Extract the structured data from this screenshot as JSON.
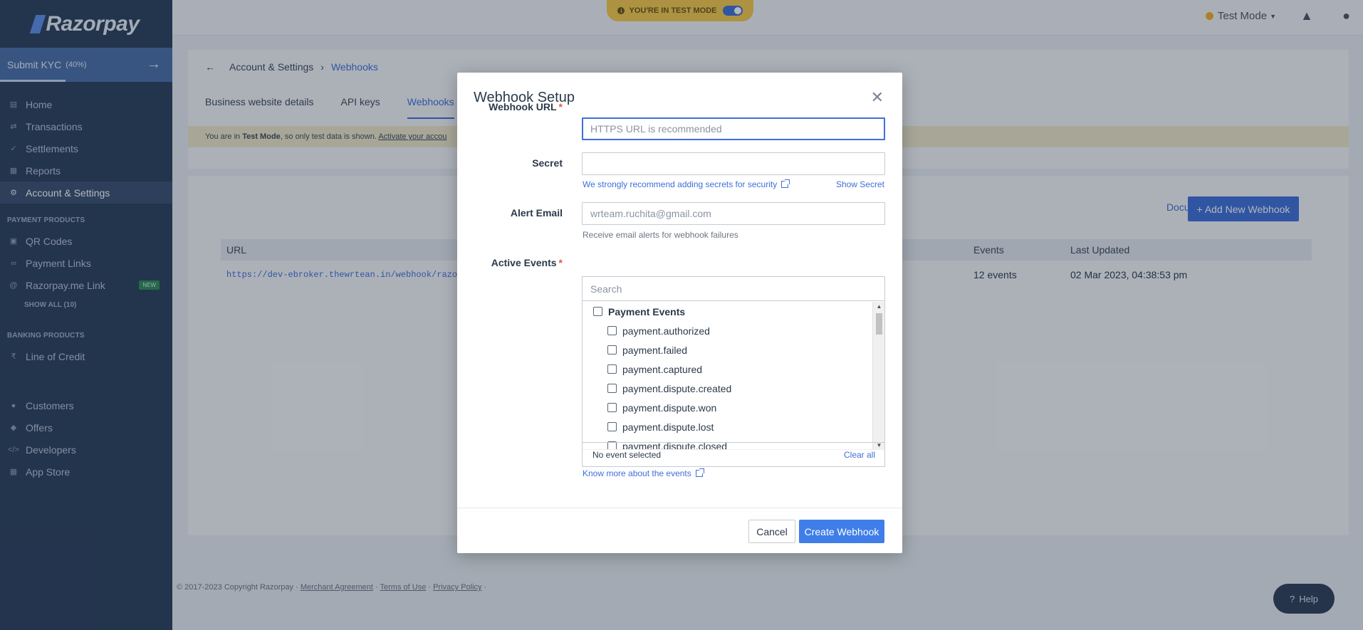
{
  "sidebar": {
    "logo": "Razorpay",
    "kyc": {
      "label": "Submit KYC",
      "percent": "(40%)",
      "progress": 0.4
    },
    "nav": [
      {
        "label": "Home",
        "icon": "home-icon"
      },
      {
        "label": "Transactions",
        "icon": "transactions-icon"
      },
      {
        "label": "Settlements",
        "icon": "settlements-icon"
      },
      {
        "label": "Reports",
        "icon": "reports-icon"
      },
      {
        "label": "Account & Settings",
        "icon": "gear-icon",
        "active": true
      }
    ],
    "payment_products_heading": "PAYMENT PRODUCTS",
    "payment_products": [
      {
        "label": "QR Codes",
        "icon": "qr-code-icon"
      },
      {
        "label": "Payment Links",
        "icon": "link-icon"
      },
      {
        "label": "Razorpay.me Link",
        "icon": "at-icon",
        "badge": "NEW"
      }
    ],
    "show_all": "SHOW ALL (10)",
    "banking_products_heading": "BANKING PRODUCTS",
    "banking_products": [
      {
        "label": "Line of Credit",
        "icon": "rupee-icon"
      }
    ],
    "bottom_nav": [
      {
        "label": "Customers",
        "icon": "customers-icon"
      },
      {
        "label": "Offers",
        "icon": "tag-icon"
      },
      {
        "label": "Developers",
        "icon": "code-icon"
      },
      {
        "label": "App Store",
        "icon": "grid-icon"
      }
    ]
  },
  "topbar": {
    "test_mode_banner": "YOU'RE IN TEST MODE",
    "mode_label": "Test Mode",
    "accent": "#f6c94b"
  },
  "page": {
    "breadcrumb": {
      "parent": "Account & Settings",
      "current": "Webhooks"
    },
    "tabs": [
      "Business website details",
      "API keys",
      "Webhooks"
    ],
    "active_tab": "Webhooks",
    "test_note": {
      "prefix": "You are in ",
      "mode": "Test Mode",
      "middle": ", so only test data is shown. ",
      "link": "Activate your accou"
    },
    "documentation_link": "Documentation",
    "add_button": "+ Add New Webhook",
    "table": {
      "headers": {
        "url": "URL",
        "events": "Events",
        "last_updated": "Last Updated"
      },
      "rows": [
        {
          "url": "https://dev-ebroker.thewrtean.in/webhook/razor",
          "events": "12 events",
          "last_updated": "02 Mar 2023, 04:38:53 pm"
        }
      ]
    },
    "footer": {
      "copyright": "© 2017-2023 Copyright Razorpay · ",
      "links": [
        "Merchant Agreement",
        "Terms of Use",
        "Privacy Policy"
      ]
    },
    "help_button": "Help"
  },
  "modal": {
    "title": "Webhook Setup",
    "webhook_url": {
      "label": "Webhook URL",
      "placeholder": "HTTPS URL is recommended",
      "value": ""
    },
    "secret": {
      "label": "Secret",
      "value": "",
      "help": "We strongly recommend adding secrets for security",
      "show_label": "Show Secret"
    },
    "alert_email": {
      "label": "Alert Email",
      "placeholder": "wrteam.ruchita@gmail.com",
      "hint": "Receive email alerts for webhook failures"
    },
    "active_events": {
      "label": "Active Events",
      "search_placeholder": "Search",
      "group": "Payment Events",
      "events": [
        "payment.authorized",
        "payment.failed",
        "payment.captured",
        "payment.dispute.created",
        "payment.dispute.won",
        "payment.dispute.lost",
        "payment.dispute.closed"
      ],
      "status": "No event selected",
      "clear_all": "Clear all"
    },
    "know_more_link": "Know more about the events",
    "cancel_button": "Cancel",
    "create_button": "Create Webhook",
    "primary_color": "#3f7ee8"
  }
}
